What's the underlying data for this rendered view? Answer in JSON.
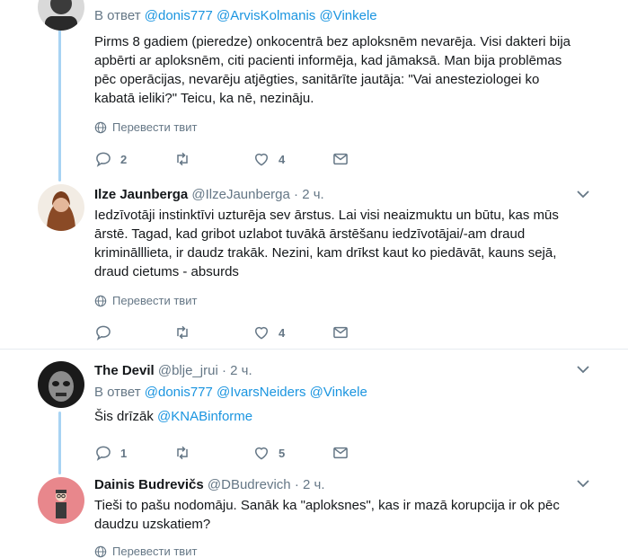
{
  "translate_label": "Перевести твит",
  "reply_prefix": "В ответ",
  "tweets": [
    {
      "reply_mentions": [
        "@donis777",
        "@ArvisKolmanis",
        "@Vinkele"
      ],
      "text": "Pirms 8 gadiem (pieredze) onkocentrā bez aploksnēm nevarēja. Visi dakteri bija apbērti ar aploksnēm, citi pacienti informēja, kad jāmaksā. Man bija problēmas pēc operācijas, nevarēju atjēgties, sanitārīte jautāja: \"Vai anesteziologei ko kabatā ieliki?\" Teicu, ka nē, nezināju.",
      "replies": "2",
      "retweets": "",
      "likes": "4"
    },
    {
      "name": "Ilze Jaunberga",
      "handle": "@IlzeJaunberga",
      "time": "2 ч.",
      "text": "Iedzīvotāji instinktīvi uzturēja sev ārstus. Lai visi neaizmuktu un būtu, kas mūs ārstē. Tagad, kad gribot uzlabot tuvākā ārstēšanu iedzīvotājai/-am draud kriminālllieta, ir daudz trakāk. Nezini, kam drīkst kaut ko piedāvāt, kauns sejā, draud cietums - absurds",
      "replies": "",
      "retweets": "",
      "likes": "4"
    },
    {
      "name": "The Devil",
      "handle": "@blje_jrui",
      "time": "2 ч.",
      "reply_mentions": [
        "@donis777",
        "@IvarsNeiders",
        "@Vinkele"
      ],
      "text": "Šis drīzāk",
      "text_mention": "@KNABinforme",
      "replies": "1",
      "retweets": "",
      "likes": "5"
    },
    {
      "name": "Dainis Budrevičs",
      "handle": "@DBudrevich",
      "time": "2 ч.",
      "text": "Tieši to pašu nodomāju. Sanāk ka \"aploksnes\", kas ir mazā korupcija ir ok pēc daudzu uzskatiem?"
    }
  ],
  "colors": {
    "accent": "#1b95e0",
    "muted": "#657786",
    "thread_line": "#a8d3f3",
    "divider": "#e6ecf0"
  }
}
